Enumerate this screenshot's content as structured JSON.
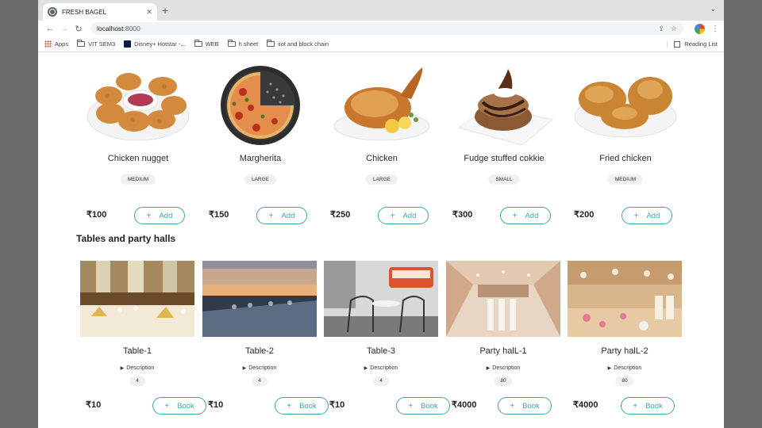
{
  "browser": {
    "tab_title": "FRESH BAGEL",
    "tab_close": "✕",
    "new_tab": "+",
    "tab_search": "⌄",
    "url_host": "localhost",
    "url_port": ":8000",
    "bookmarks": [
      "Apps",
      "VIT SEM3",
      "Disney+ Hotstar -...",
      "WEB",
      "h sheet",
      "iiot and block chain"
    ],
    "reading_list": "Reading List"
  },
  "menu": {
    "items": [
      {
        "name": "Chicken nugget",
        "size": "MEDIUM",
        "price": "₹100",
        "action": "Add",
        "icon": "nuggets-image"
      },
      {
        "name": "Margherita",
        "size": "LARGE",
        "price": "₹150",
        "action": "Add",
        "icon": "pizza-image"
      },
      {
        "name": "Chicken",
        "size": "LARGE",
        "price": "₹250",
        "action": "Add",
        "icon": "roast-chicken-image"
      },
      {
        "name": "Fudge stuffed cokkie",
        "size": "SMALL",
        "price": "₹300",
        "action": "Add",
        "icon": "cookie-image"
      },
      {
        "name": "Fried chicken",
        "size": "MEDIUM",
        "price": "₹200",
        "action": "Add",
        "icon": "fried-chicken-image"
      }
    ]
  },
  "venues": {
    "heading": "Tables and party halls",
    "items": [
      {
        "name": "Table-1",
        "description": "Description",
        "capacity": "4",
        "price": "₹10",
        "action": "Book"
      },
      {
        "name": "Table-2",
        "description": "Description",
        "capacity": "4",
        "price": "₹10",
        "action": "Book"
      },
      {
        "name": "Table-3",
        "description": "Description",
        "capacity": "4",
        "price": "₹10",
        "action": "Book"
      },
      {
        "name": "Party halL-1",
        "description": "Description",
        "capacity": "80",
        "price": "₹4000",
        "action": "Book"
      },
      {
        "name": "Party halL-2",
        "description": "Description",
        "capacity": "80",
        "price": "₹4000",
        "action": "Book"
      }
    ]
  },
  "colors": {
    "accent": "#3fa7a8",
    "badge": "#f0f0f0"
  }
}
